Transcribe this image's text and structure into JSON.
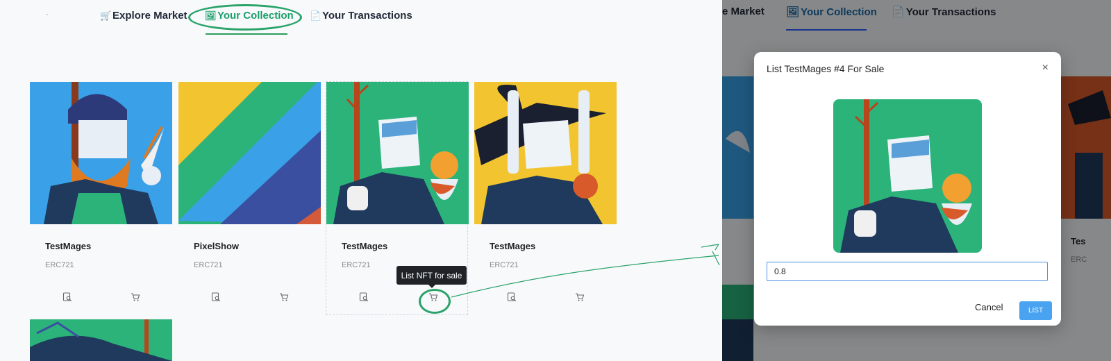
{
  "nav": {
    "caret": "ˇ",
    "items": [
      {
        "label": "Explore Market",
        "icon": "cart-icon"
      },
      {
        "label": "Your Collection",
        "icon": "picture-icon"
      },
      {
        "label": "Your Transactions",
        "icon": "document-icon"
      }
    ]
  },
  "cards": [
    {
      "name": "TestMages",
      "standard": "ERC721"
    },
    {
      "name": "PixelShow",
      "standard": "ERC721"
    },
    {
      "name": "TestMages",
      "standard": "ERC721"
    },
    {
      "name": "TestMages",
      "standard": "ERC721"
    }
  ],
  "tooltip": "List NFT for sale",
  "right_panel": {
    "nav_items": [
      "e Market",
      "Your Collection",
      "Your Transactions"
    ],
    "bg_partial_name": "Tes",
    "bg_partial_std": "ERC",
    "modal": {
      "title": "List TestMages #4 For Sale",
      "close": "×",
      "price_value": "0.8",
      "cancel_label": "Cancel",
      "list_label": "LIST"
    }
  },
  "colors": {
    "active_green": "#1a9e6a",
    "highlight_green": "#2aa36a",
    "primary_blue": "#4aa3f0",
    "card_green": "#2bb37a",
    "card_blue": "#3aa0e8",
    "card_yellow": "#f2c530"
  }
}
